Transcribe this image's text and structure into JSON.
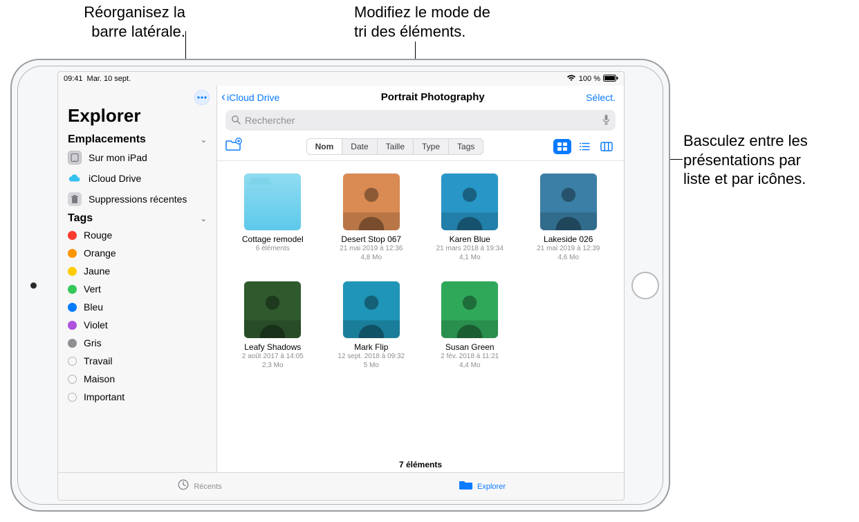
{
  "callouts": {
    "sidebar": "Réorganisez la\nbarre latérale.",
    "sort": "Modifiez le mode de\ntri des éléments.",
    "view": "Basculez entre les\nprésentations par\nliste et par icônes."
  },
  "statusbar": {
    "time": "09:41",
    "date": "Mar. 10 sept.",
    "wifi": "wifi",
    "battery_pct": "100 %",
    "battery_icon": "battery"
  },
  "sidebar": {
    "more_icon": "more-icon",
    "title": "Explorer",
    "locations_header": "Emplacements",
    "locations": [
      {
        "icon": "ipad",
        "label": "Sur mon iPad"
      },
      {
        "icon": "cloud",
        "label": "iCloud Drive"
      },
      {
        "icon": "trash",
        "label": "Suppressions récentes"
      }
    ],
    "tags_header": "Tags",
    "tags": [
      {
        "color": "#ff3b30",
        "label": "Rouge"
      },
      {
        "color": "#ff9500",
        "label": "Orange"
      },
      {
        "color": "#ffcc00",
        "label": "Jaune"
      },
      {
        "color": "#34c759",
        "label": "Vert"
      },
      {
        "color": "#007aff",
        "label": "Bleu"
      },
      {
        "color": "#af52de",
        "label": "Violet"
      },
      {
        "color": "#8e8e93",
        "label": "Gris"
      },
      {
        "color": "",
        "label": "Travail"
      },
      {
        "color": "",
        "label": "Maison"
      },
      {
        "color": "",
        "label": "Important"
      }
    ]
  },
  "nav": {
    "back_label": "iCloud Drive",
    "title": "Portrait Photography",
    "select_label": "Sélect."
  },
  "search": {
    "placeholder": "Rechercher",
    "mic_icon": "mic"
  },
  "toolbar": {
    "newfolder_icon": "new-folder",
    "sort": [
      {
        "label": "Nom",
        "selected": true
      },
      {
        "label": "Date",
        "selected": false
      },
      {
        "label": "Taille",
        "selected": false
      },
      {
        "label": "Type",
        "selected": false
      },
      {
        "label": "Tags",
        "selected": false
      }
    ],
    "view": {
      "icons_active": true
    }
  },
  "files": [
    {
      "kind": "folder",
      "name": "Cottage remodel",
      "meta1": "6 éléments",
      "meta2": ""
    },
    {
      "kind": "image",
      "name": "Desert Stop 067",
      "meta1": "21 mai 2019 à 12:36",
      "meta2": "4,8 Mo",
      "thumb_bg": "#d98b53"
    },
    {
      "kind": "image",
      "name": "Karen Blue",
      "meta1": "21 mars 2018 à 19:34",
      "meta2": "4,1 Mo",
      "thumb_bg": "#2896c7"
    },
    {
      "kind": "image",
      "name": "Lakeside 026",
      "meta1": "21 mai 2019 à 12:39",
      "meta2": "4,6 Mo",
      "thumb_bg": "#3b7fa6"
    },
    {
      "kind": "image",
      "name": "Leafy Shadows",
      "meta1": "2 août 2017 à 14:05",
      "meta2": "2,3 Mo",
      "thumb_bg": "#2f5a2e"
    },
    {
      "kind": "image",
      "name": "Mark Flip",
      "meta1": "12 sept. 2018 à 09:32",
      "meta2": "5 Mo",
      "thumb_bg": "#1f95b7"
    },
    {
      "kind": "image",
      "name": "Susan Green",
      "meta1": "2 fév. 2018 à 11:21",
      "meta2": "4,4 Mo",
      "thumb_bg": "#2fa85a"
    }
  ],
  "footer_count": "7 éléments",
  "tabbar": {
    "recents": "Récents",
    "browse": "Explorer"
  }
}
